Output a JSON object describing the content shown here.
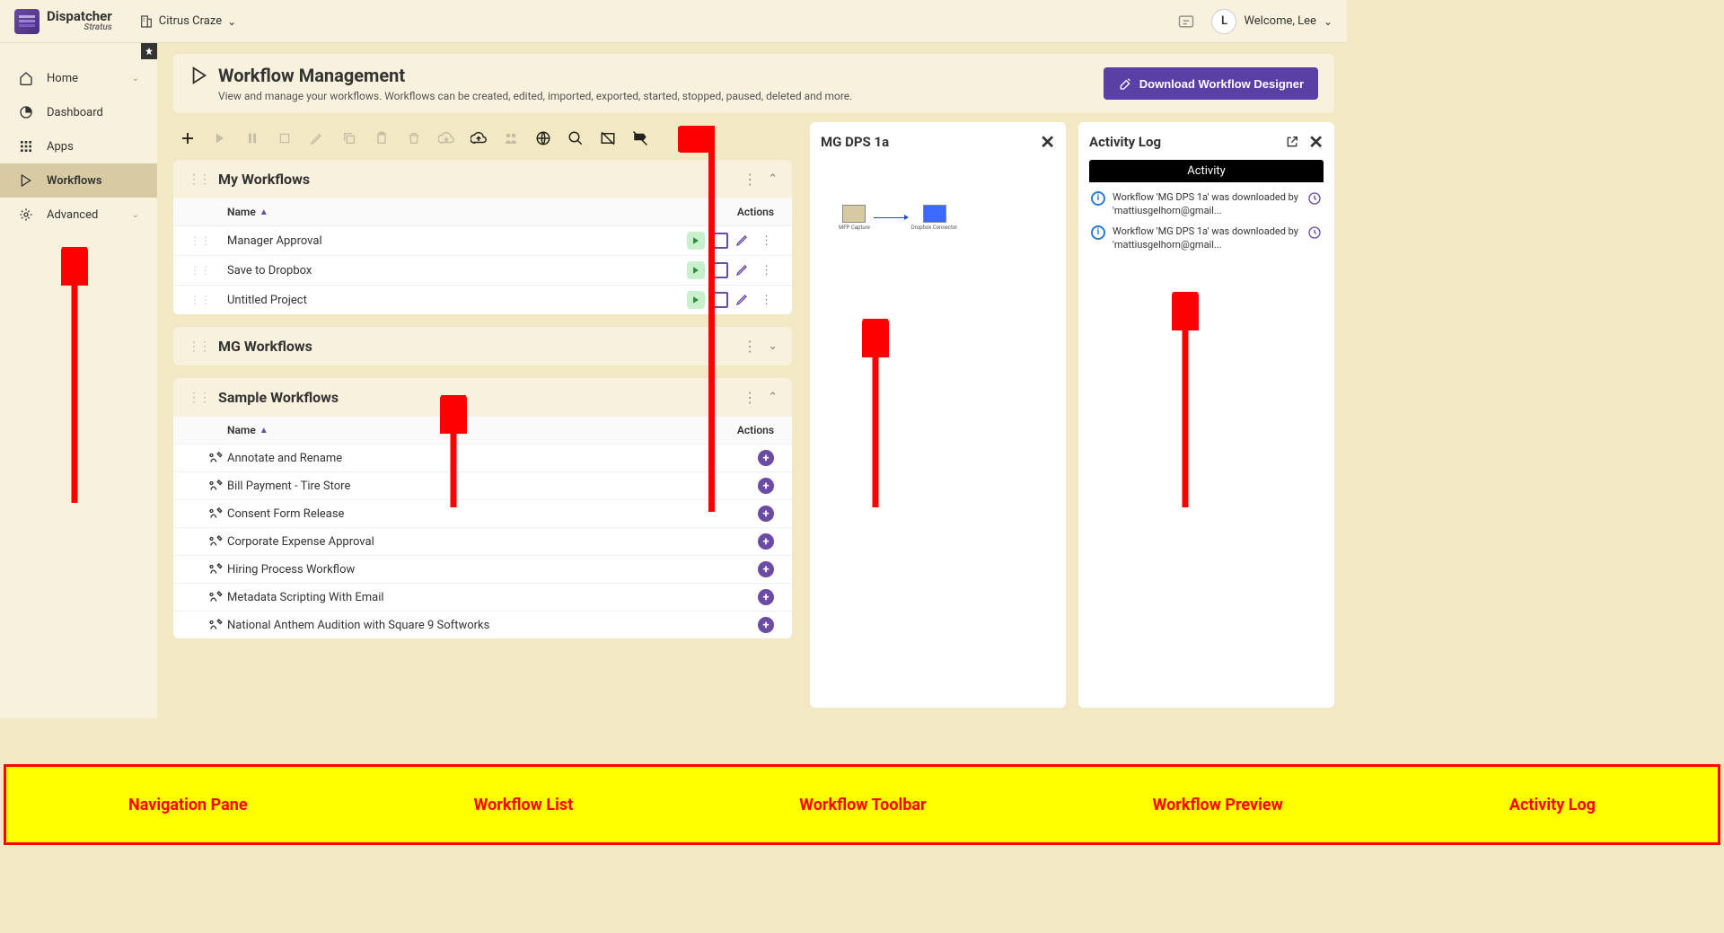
{
  "brand": {
    "main": "Dispatcher",
    "sub": "Stratus"
  },
  "tenant": "Citrus Craze",
  "user": {
    "greeting": "Welcome, Lee",
    "initial": "L"
  },
  "nav": {
    "items": [
      {
        "label": "Home",
        "icon": "home",
        "expandable": true
      },
      {
        "label": "Dashboard",
        "icon": "dashboard"
      },
      {
        "label": "Apps",
        "icon": "apps"
      },
      {
        "label": "Workflows",
        "icon": "workflow",
        "active": true
      },
      {
        "label": "Advanced",
        "icon": "gear",
        "expandable": true
      }
    ]
  },
  "page": {
    "title": "Workflow Management",
    "desc": "View and manage your workflows. Workflows can be created, edited, imported, exported, started, stopped, paused, deleted and more.",
    "download_btn": "Download Workflow Designer"
  },
  "columns": {
    "name": "Name",
    "actions": "Actions"
  },
  "groups": {
    "my": {
      "title": "My Workflows",
      "rows": [
        {
          "name": "Manager Approval"
        },
        {
          "name": "Save to Dropbox"
        },
        {
          "name": "Untitled Project"
        }
      ]
    },
    "mg": {
      "title": "MG Workflows"
    },
    "sample": {
      "title": "Sample Workflows",
      "rows": [
        {
          "name": "Annotate and Rename"
        },
        {
          "name": "Bill Payment - Tire Store"
        },
        {
          "name": "Consent Form Release"
        },
        {
          "name": "Corporate Expense Approval"
        },
        {
          "name": "Hiring Process Workflow"
        },
        {
          "name": "Metadata Scripting With Email"
        },
        {
          "name": "National Anthem Audition with Square 9 Softworks"
        }
      ]
    }
  },
  "preview": {
    "title": "MG DPS 1a",
    "node_start": "MFP Capture",
    "node_end": "Dropbox Connector"
  },
  "activity": {
    "title": "Activity Log",
    "tab": "Activity",
    "entries": [
      {
        "text": "Workflow 'MG DPS 1a' was downloaded by 'mattiusgelhorn@gmail..."
      },
      {
        "text": "Workflow 'MG DPS 1a' was downloaded by 'mattiusgelhorn@gmail..."
      }
    ]
  },
  "annotations": {
    "nav": "Navigation Pane",
    "list": "Workflow List",
    "toolbar": "Workflow Toolbar",
    "preview": "Workflow Preview",
    "log": "Activity Log"
  }
}
